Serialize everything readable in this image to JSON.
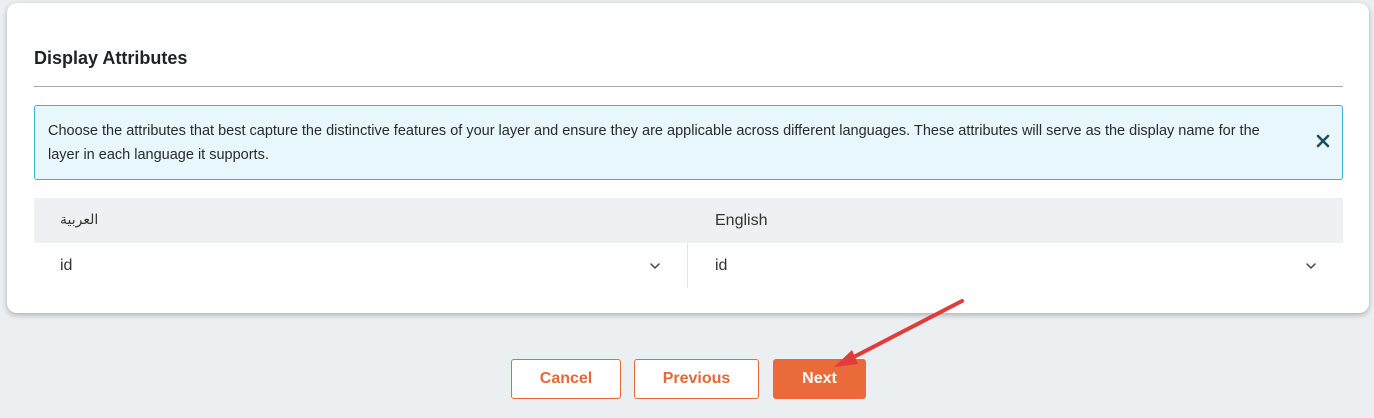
{
  "section": {
    "title": "Display Attributes"
  },
  "info": {
    "message": "Choose the attributes that best capture the distinctive features of your layer and ensure they are applicable across different languages. These attributes will serve as the display name for the layer in each language it supports.",
    "close_icon": "close-icon"
  },
  "table": {
    "columns": [
      {
        "label": "العربية"
      },
      {
        "label": "English"
      }
    ],
    "row": [
      {
        "value": "id"
      },
      {
        "value": "id"
      }
    ]
  },
  "buttons": {
    "cancel": "Cancel",
    "previous": "Previous",
    "next": "Next"
  },
  "colors": {
    "accent": "#ea6a3a",
    "info_border": "#36b6cf",
    "info_background": "#e8f7fb",
    "annotation_arrow": "#e03c3c"
  }
}
